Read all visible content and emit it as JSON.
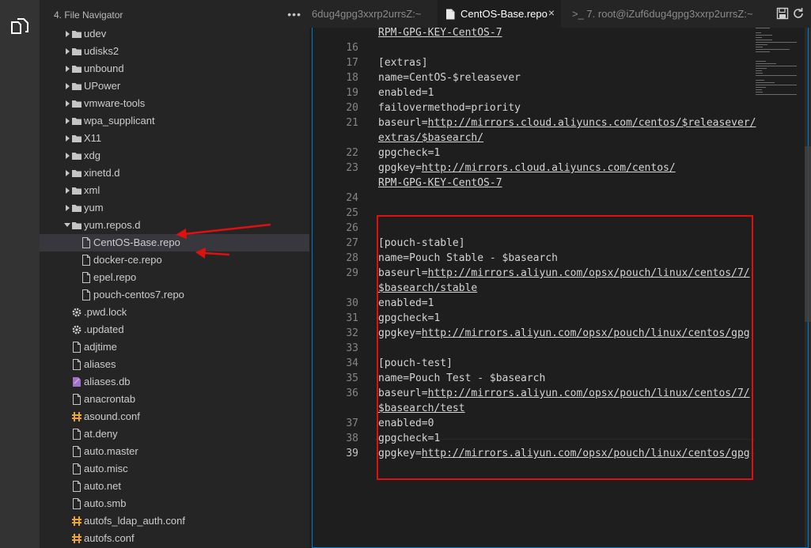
{
  "sidebar": {
    "title": "4. File Navigator",
    "more_icon": "ellipsis-icon",
    "items": [
      {
        "label": "udev",
        "type": "folder",
        "indent": 1,
        "expanded": false
      },
      {
        "label": "udisks2",
        "type": "folder",
        "indent": 1,
        "expanded": false
      },
      {
        "label": "unbound",
        "type": "folder",
        "indent": 1,
        "expanded": false
      },
      {
        "label": "UPower",
        "type": "folder",
        "indent": 1,
        "expanded": false
      },
      {
        "label": "vmware-tools",
        "type": "folder",
        "indent": 1,
        "expanded": false
      },
      {
        "label": "wpa_supplicant",
        "type": "folder",
        "indent": 1,
        "expanded": false
      },
      {
        "label": "X11",
        "type": "folder",
        "indent": 1,
        "expanded": false
      },
      {
        "label": "xdg",
        "type": "folder",
        "indent": 1,
        "expanded": false
      },
      {
        "label": "xinetd.d",
        "type": "folder",
        "indent": 1,
        "expanded": false
      },
      {
        "label": "xml",
        "type": "folder",
        "indent": 1,
        "expanded": false
      },
      {
        "label": "yum",
        "type": "folder",
        "indent": 1,
        "expanded": false
      },
      {
        "label": "yum.repos.d",
        "type": "folder",
        "indent": 1,
        "expanded": true
      },
      {
        "label": "CentOS-Base.repo",
        "type": "file",
        "indent": 2,
        "selected": true
      },
      {
        "label": "docker-ce.repo",
        "type": "file",
        "indent": 2
      },
      {
        "label": "epel.repo",
        "type": "file",
        "indent": 2
      },
      {
        "label": "pouch-centos7.repo",
        "type": "file",
        "indent": 2
      },
      {
        "label": ".pwd.lock",
        "type": "gear",
        "indent": 1
      },
      {
        "label": ".updated",
        "type": "gear",
        "indent": 1
      },
      {
        "label": "adjtime",
        "type": "file",
        "indent": 1
      },
      {
        "label": "aliases",
        "type": "file",
        "indent": 1
      },
      {
        "label": "aliases.db",
        "type": "db",
        "indent": 1
      },
      {
        "label": "anacrontab",
        "type": "file",
        "indent": 1
      },
      {
        "label": "asound.conf",
        "type": "conf",
        "indent": 1
      },
      {
        "label": "at.deny",
        "type": "file",
        "indent": 1
      },
      {
        "label": "auto.master",
        "type": "file",
        "indent": 1
      },
      {
        "label": "auto.misc",
        "type": "file",
        "indent": 1
      },
      {
        "label": "auto.net",
        "type": "file",
        "indent": 1
      },
      {
        "label": "auto.smb",
        "type": "file",
        "indent": 1
      },
      {
        "label": "autofs_ldap_auth.conf",
        "type": "conf",
        "indent": 1
      },
      {
        "label": "autofs.conf",
        "type": "conf",
        "indent": 1
      }
    ]
  },
  "tabs": [
    {
      "label": "6dug4gpg3xxrp2urrsZ:~",
      "active": false
    },
    {
      "label": "CentOS-Base.repo",
      "active": true,
      "close": "×"
    },
    {
      "label": ">_ 7. root@iZuf6dug4gpg3xxrp2urrsZ:~",
      "active": false
    }
  ],
  "tab_actions": [
    "save-icon",
    "refresh-icon"
  ],
  "editor": {
    "lines": [
      {
        "n": "",
        "segs": [
          {
            "t": "RPM-GPG-KEY-CentOS-7",
            "u": true
          }
        ]
      },
      {
        "n": "16",
        "segs": []
      },
      {
        "n": "17",
        "segs": [
          {
            "t": "[extras]"
          }
        ]
      },
      {
        "n": "18",
        "segs": [
          {
            "t": "name=CentOS-$releasever"
          }
        ]
      },
      {
        "n": "19",
        "segs": [
          {
            "t": "enabled=1"
          }
        ]
      },
      {
        "n": "20",
        "segs": [
          {
            "t": "failovermethod=priority"
          }
        ]
      },
      {
        "n": "21",
        "segs": [
          {
            "t": "baseurl="
          },
          {
            "t": "http://mirrors.cloud.aliyuncs.com/centos/$releasever/",
            "u": true
          }
        ]
      },
      {
        "n": "",
        "segs": [
          {
            "t": "extras/$basearch/",
            "u": true
          }
        ]
      },
      {
        "n": "22",
        "segs": [
          {
            "t": "gpgcheck=1"
          }
        ]
      },
      {
        "n": "23",
        "segs": [
          {
            "t": "gpgkey="
          },
          {
            "t": "http://mirrors.cloud.aliyuncs.com/centos/",
            "u": true
          }
        ]
      },
      {
        "n": "",
        "segs": [
          {
            "t": "RPM-GPG-KEY-CentOS-7",
            "u": true
          }
        ]
      },
      {
        "n": "24",
        "segs": []
      },
      {
        "n": "25",
        "segs": []
      },
      {
        "n": "26",
        "segs": []
      },
      {
        "n": "27",
        "segs": [
          {
            "t": "[pouch-stable]"
          }
        ]
      },
      {
        "n": "28",
        "segs": [
          {
            "t": "name=Pouch Stable - $basearch"
          }
        ]
      },
      {
        "n": "29",
        "segs": [
          {
            "t": "baseurl="
          },
          {
            "t": "http://mirrors.aliyun.com/opsx/pouch/linux/centos/7/",
            "u": true
          }
        ]
      },
      {
        "n": "",
        "segs": [
          {
            "t": "$basearch/stable",
            "u": true
          }
        ]
      },
      {
        "n": "30",
        "segs": [
          {
            "t": "enabled=1"
          }
        ]
      },
      {
        "n": "31",
        "segs": [
          {
            "t": "gpgcheck=1"
          }
        ]
      },
      {
        "n": "32",
        "segs": [
          {
            "t": "gpgkey="
          },
          {
            "t": "http://mirrors.aliyun.com/opsx/pouch/linux/centos/gpg",
            "u": true
          }
        ]
      },
      {
        "n": "33",
        "segs": []
      },
      {
        "n": "34",
        "segs": [
          {
            "t": "[pouch-test]"
          }
        ]
      },
      {
        "n": "35",
        "segs": [
          {
            "t": "name=Pouch Test - $basearch"
          }
        ]
      },
      {
        "n": "36",
        "segs": [
          {
            "t": "baseurl="
          },
          {
            "t": "http://mirrors.aliyun.com/opsx/pouch/linux/centos/7/",
            "u": true
          }
        ]
      },
      {
        "n": "",
        "segs": [
          {
            "t": "$basearch/test",
            "u": true
          }
        ]
      },
      {
        "n": "37",
        "segs": [
          {
            "t": "enabled=0"
          }
        ]
      },
      {
        "n": "38",
        "segs": [
          {
            "t": "gpgcheck=1"
          }
        ]
      },
      {
        "n": "39",
        "segs": [
          {
            "t": "gpgkey="
          },
          {
            "t": "http://mirrors.aliyun.com/opsx/pouch/linux/centos/gpg",
            "u": true
          }
        ],
        "active": true
      }
    ]
  },
  "colors": {
    "accent": "#007acc",
    "annotation": "#e01010",
    "folder": "#c5c5c5",
    "conf_icon": "#e8a33d"
  }
}
